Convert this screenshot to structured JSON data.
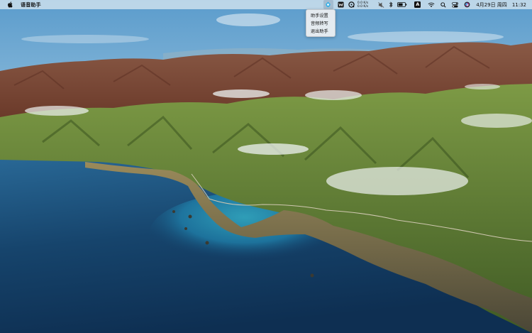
{
  "menubar": {
    "apple_icon": "apple-logo-icon",
    "app_name": "语音助手",
    "status_icons": [
      "assistant-icon",
      "w-app-icon",
      "quicktime-icon",
      "network-speed-icon",
      "mute-icon",
      "bluetooth-icon",
      "battery-icon",
      "input-method-icon",
      "wifi-icon",
      "search-icon",
      "control-center-icon",
      "siri-icon"
    ],
    "network": {
      "up": "0.0 K/s",
      "down": "0.0 K/s"
    },
    "input_method": "A",
    "date": "4月29日 周四",
    "time": "11:32"
  },
  "dropdown": {
    "items": [
      "助手设置",
      "音频转写",
      "退出助手"
    ]
  },
  "colors": {
    "menubar_bg": "#e1ebf2",
    "ocean": "#1d4f7a",
    "hills": "#5d7a35"
  }
}
